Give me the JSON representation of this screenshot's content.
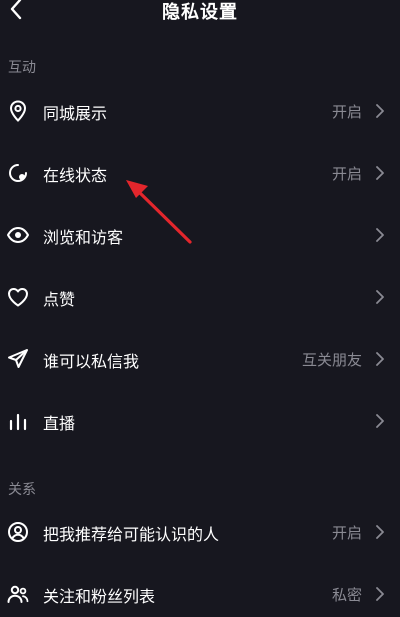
{
  "header": {
    "title": "隐私设置"
  },
  "sections": [
    {
      "label": "互动",
      "items": [
        {
          "label": "同城展示",
          "value": "开启",
          "icon": "location-pin-icon"
        },
        {
          "label": "在线状态",
          "value": "开启",
          "icon": "online-status-icon"
        },
        {
          "label": "浏览和访客",
          "value": "",
          "icon": "eye-icon"
        },
        {
          "label": "点赞",
          "value": "",
          "icon": "heart-icon"
        },
        {
          "label": "谁可以私信我",
          "value": "互关朋友",
          "icon": "send-icon"
        },
        {
          "label": "直播",
          "value": "",
          "icon": "bars-icon"
        }
      ]
    },
    {
      "label": "关系",
      "items": [
        {
          "label": "把我推荐给可能认识的人",
          "value": "开启",
          "icon": "person-circle-icon"
        },
        {
          "label": "关注和粉丝列表",
          "value": "私密",
          "icon": "people-icon"
        }
      ]
    }
  ],
  "colors": {
    "background": "#17171f",
    "text": "#ffffff",
    "secondary_text": "#8a8a93",
    "annotation_arrow": "#e3262c"
  }
}
